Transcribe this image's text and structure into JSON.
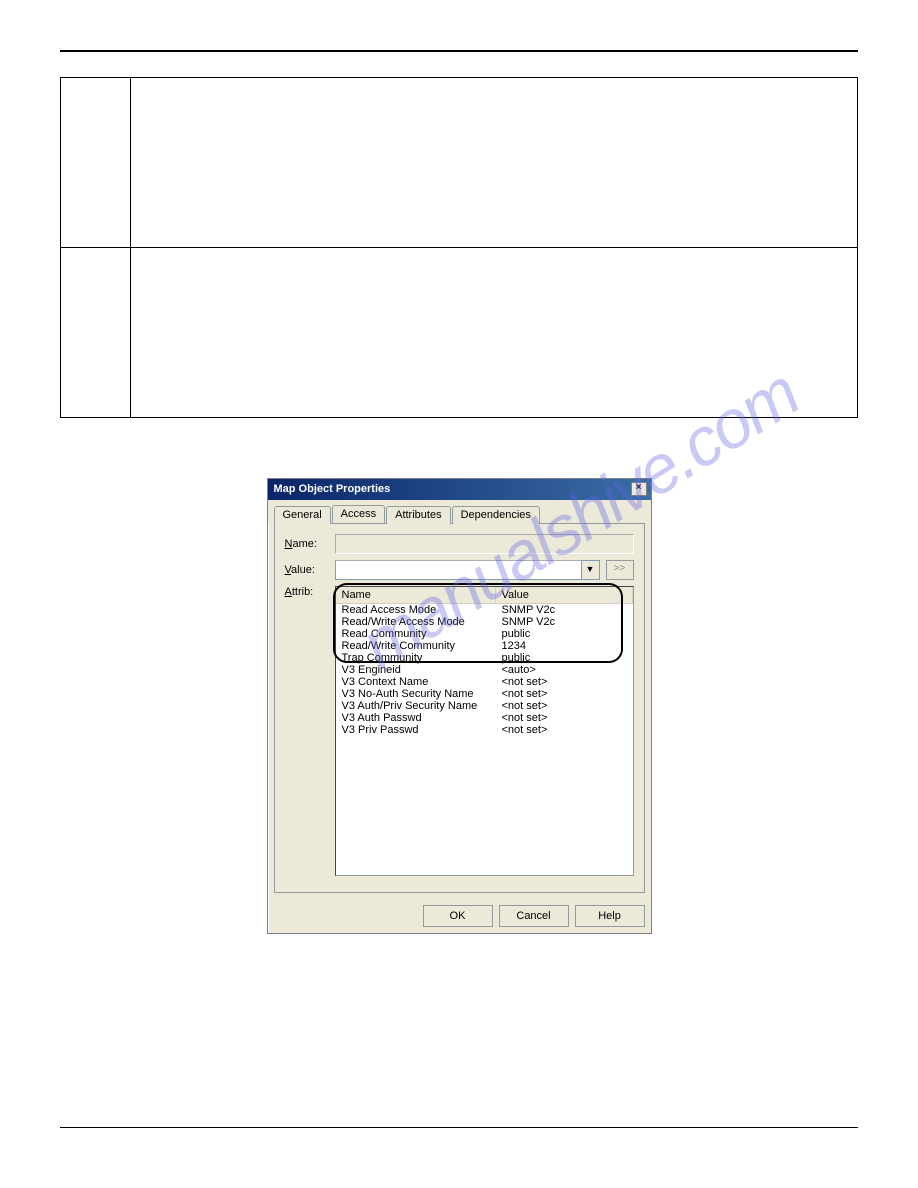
{
  "dialog": {
    "title": "Map Object Properties",
    "tabs": [
      "General",
      "Access",
      "Attributes",
      "Dependencies"
    ],
    "activeTab": "Access",
    "labels": {
      "name": "Name:",
      "value": "Value:",
      "attrib": "Attrib:"
    },
    "valueField": "",
    "goBtn": ">>",
    "listHeaders": [
      "Name",
      "Value"
    ],
    "rows": [
      {
        "name": "Read Access Mode",
        "value": "SNMP V2c"
      },
      {
        "name": "Read/Write Access Mode",
        "value": "SNMP V2c"
      },
      {
        "name": "Read Community",
        "value": "public"
      },
      {
        "name": "Read/Write Community",
        "value": "1234"
      },
      {
        "name": "Trap Community",
        "value": "public"
      },
      {
        "name": "V3 Engineid",
        "value": "<auto>"
      },
      {
        "name": "V3 Context Name",
        "value": "<not set>"
      },
      {
        "name": "V3 No-Auth Security Name",
        "value": "<not set>"
      },
      {
        "name": "V3 Auth/Priv Security Name",
        "value": "<not set>"
      },
      {
        "name": "V3 Auth Passwd",
        "value": "<not set>"
      },
      {
        "name": "V3 Priv Passwd",
        "value": "<not set>"
      }
    ],
    "buttons": {
      "ok": "OK",
      "cancel": "Cancel",
      "help": "Help"
    }
  },
  "watermark": "manualshive.com"
}
